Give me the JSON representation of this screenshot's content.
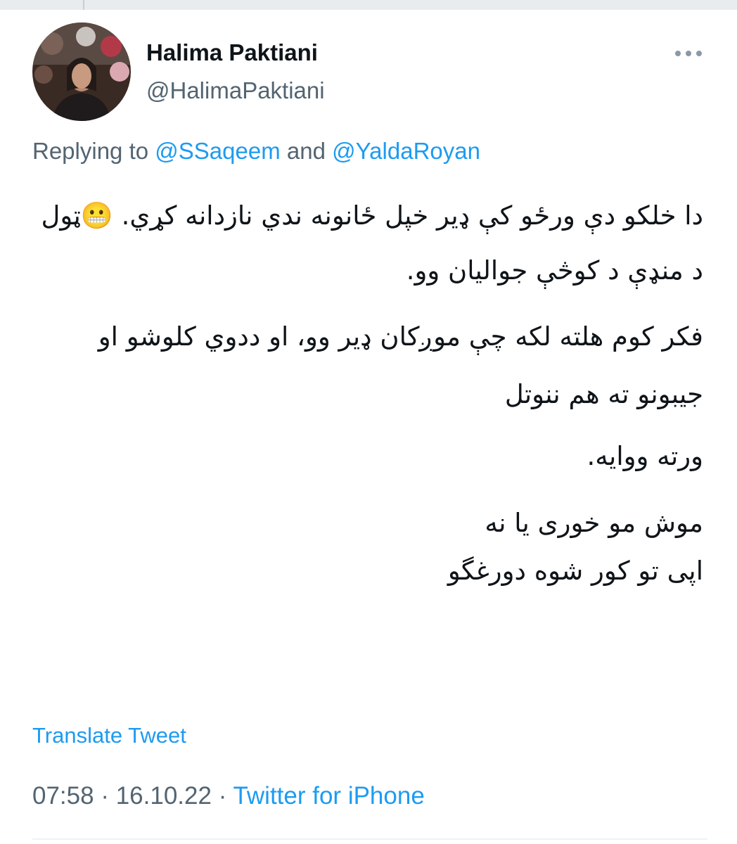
{
  "tweet": {
    "author": {
      "name": "Halima Paktiani",
      "handle": "@HalimaPaktiani"
    },
    "more_icon": "more-horizontal-icon",
    "replying": {
      "prefix": "Replying to",
      "user1": "@SSaqeem",
      "conjunction": "and",
      "user2": "@YaldaRoyan"
    },
    "paragraphs": [
      "دا خلکو دې ورځو کې ډیر خپل ځانونه ندي نازدانه کړي. 😬ټول د منډې د کوڅې جوالیان وو.",
      "فکر کوم هلته لکه چې موږکان ډیر وو، او ددوي کلوشو او جیبونو ته هم ننوتل",
      "ورته ووایه.",
      "موش مو خوری یا نه\nاپی تو کور شوه دورغگو"
    ],
    "translate_label": "Translate Tweet",
    "time": "07:58",
    "date": "16.10.22",
    "source": "Twitter for iPhone",
    "separator": "·",
    "colors": {
      "link": "#1d9bf0",
      "secondary_text": "#536471",
      "primary_text": "#0f1419"
    }
  }
}
